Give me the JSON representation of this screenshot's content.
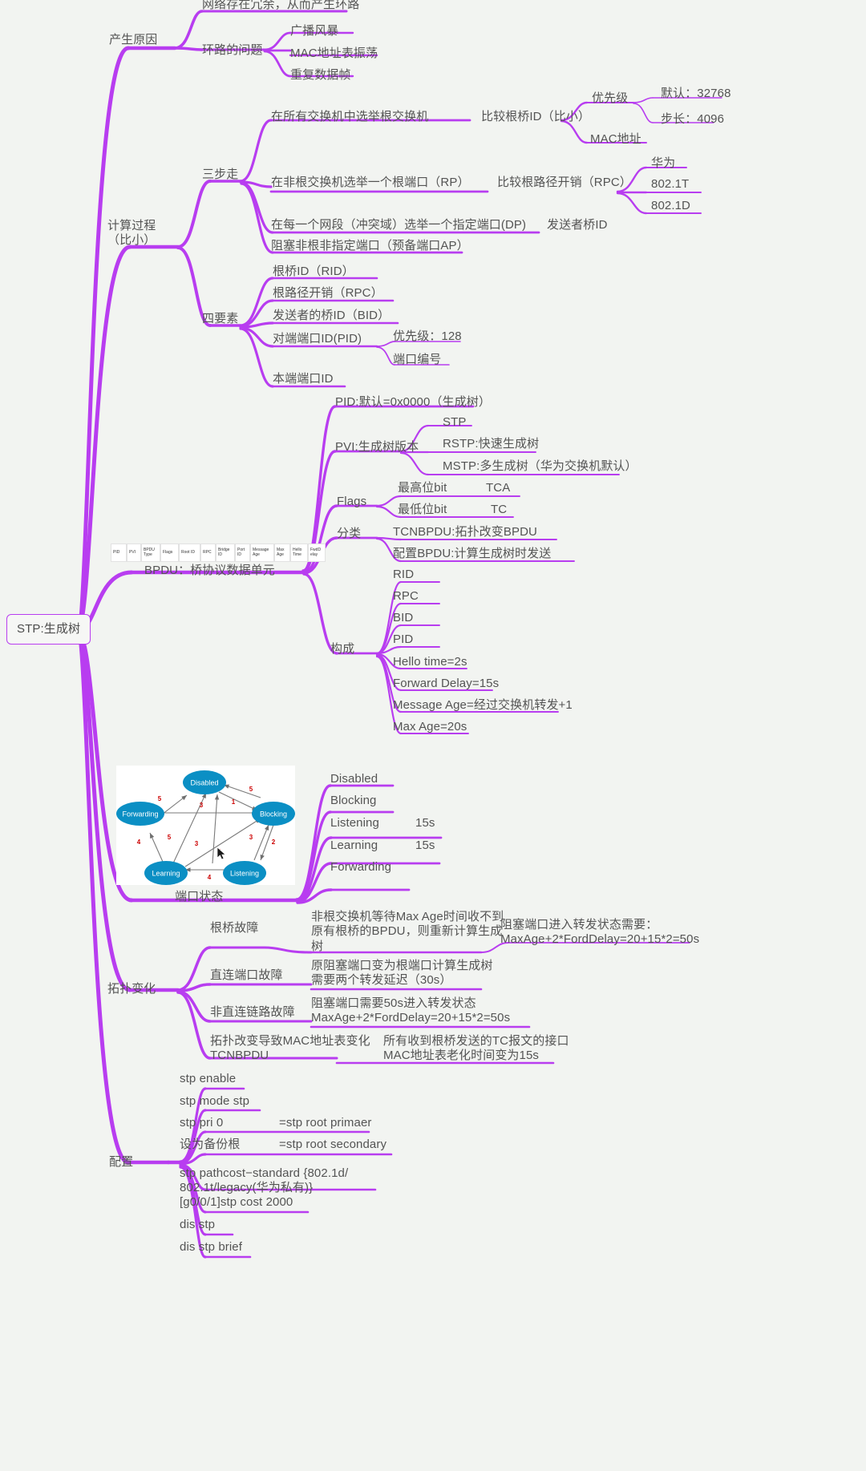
{
  "theme": {
    "background": "#f2f4f1",
    "branch_color": "#b83df0",
    "text_color": "#545454",
    "node_color": "#0b8fc4",
    "number_color": "#cc0000"
  },
  "root": {
    "label": "STP:生成树"
  },
  "branch1": {
    "label": "产生原因",
    "items": [
      {
        "label": "网络存在冗余，从而产生环路"
      },
      {
        "label": "环路的问题",
        "children": [
          {
            "label": "广播风暴"
          },
          {
            "label": "MAC地址表振荡"
          },
          {
            "label": "重复数据帧"
          }
        ]
      }
    ]
  },
  "branch2": {
    "label": "计算过程\n（比小）",
    "groups": [
      {
        "label": "三步走",
        "items": [
          {
            "label": "在所有交换机中选举根交换机",
            "detail": "比较根桥ID（比小）",
            "children": [
              {
                "label": "优先级",
                "children": [
                  {
                    "label": "默认：32768"
                  },
                  {
                    "label": "步长：4096"
                  }
                ]
              },
              {
                "label": "MAC地址"
              }
            ]
          },
          {
            "label": "在非根交换机选举一个根端口（RP）",
            "detail": "比较根路径开销（RPC）",
            "children": [
              {
                "label": "华为"
              },
              {
                "label": "802.1T"
              },
              {
                "label": "802.1D"
              }
            ]
          },
          {
            "label": "在每一个网段（冲突域）选举一个指定端口(DP)",
            "detail": "发送者桥ID"
          },
          {
            "label": "阻塞非根非指定端口（预备端口AP）"
          }
        ]
      },
      {
        "label": "四要素",
        "items": [
          {
            "label": "根桥ID（RID）"
          },
          {
            "label": "根路径开销（RPC）"
          },
          {
            "label": "发送者的桥ID（BID）"
          },
          {
            "label": "对端端口ID(PID)",
            "children": [
              {
                "label": "优先级：128"
              },
              {
                "label": "端口编号"
              }
            ]
          },
          {
            "label": "本端端口ID"
          }
        ]
      }
    ]
  },
  "branch3": {
    "label": "BPDU：桥协议数据单元",
    "frame_fields": [
      "PID",
      "PVI",
      "BPDU\nType",
      "Flags",
      "Root ID",
      "RPC",
      "Bridge\nID",
      "Port\nID",
      "Message\nAge",
      "Max\nAge",
      "Hello\nTime",
      "FwdD\nelay"
    ],
    "items": [
      {
        "label": "PID:默认=0x0000（生成树）"
      },
      {
        "label": "PVI:生成树版本",
        "children": [
          {
            "label": "STP"
          },
          {
            "label": "RSTP:快速生成树"
          },
          {
            "label": "MSTP:多生成树（华为交换机默认）"
          }
        ]
      },
      {
        "label": "Flags",
        "children": [
          {
            "label": "最高位bit",
            "detail": "TCA"
          },
          {
            "label": "最低位bit",
            "detail": "TC"
          }
        ]
      },
      {
        "label": "分类",
        "children": [
          {
            "label": "TCNBPDU:拓扑改变BPDU"
          },
          {
            "label": "配置BPDU:计算生成树时发送"
          }
        ]
      },
      {
        "label": "构成",
        "children": [
          {
            "label": "RID"
          },
          {
            "label": "RPC"
          },
          {
            "label": "BID"
          },
          {
            "label": "PID"
          },
          {
            "label": "Hello time=2s"
          },
          {
            "label": "Forward Delay=15s"
          },
          {
            "label": "Message Age=经过交换机转发+1"
          },
          {
            "label": "Max Age=20s"
          }
        ]
      }
    ]
  },
  "branch4": {
    "label": "端口状态",
    "diagram": {
      "nodes": [
        {
          "id": "Disabled",
          "label": "Disabled"
        },
        {
          "id": "Forwarding",
          "label": "Forwarding"
        },
        {
          "id": "Blocking",
          "label": "Blocking"
        },
        {
          "id": "Learning",
          "label": "Learning"
        },
        {
          "id": "Listening",
          "label": "Listening"
        }
      ],
      "edge_numbers": [
        "5",
        "5",
        "1",
        "3",
        "5",
        "4",
        "3",
        "5",
        "3",
        "2",
        "4"
      ]
    },
    "items": [
      {
        "label": "Disabled",
        "detail": ""
      },
      {
        "label": "Blocking",
        "detail": ""
      },
      {
        "label": "Listening",
        "detail": "15s"
      },
      {
        "label": "Learning",
        "detail": "15s"
      },
      {
        "label": "Forwarding",
        "detail": ""
      }
    ]
  },
  "branch5": {
    "label": "拓扑变化",
    "items": [
      {
        "label": "根桥故障",
        "detail": "非根交换机等待Max Age时间收不到\n原有根桥的BPDU，则重新计算生成\n树",
        "children": [
          {
            "label": "阻塞端口进入转发状态需要：\nMaxAge+2*FordDelay=20+15*2=50s"
          }
        ]
      },
      {
        "label": "直连端口故障",
        "detail": "原阻塞端口变为根端口计算生成树\n需要两个转发延迟（30s）"
      },
      {
        "label": "非直连链路故障",
        "detail": "阻塞端口需要50s进入转发状态\nMaxAge+2*FordDelay=20+15*2=50s"
      },
      {
        "label": "拓扑改变导致MAC地址表变化\nTCNBPDU",
        "detail": "所有收到根桥发送的TC报文的接口\nMAC地址表老化时间变为15s"
      }
    ]
  },
  "branch6": {
    "label": "配置",
    "items": [
      {
        "label": "stp enable",
        "detail": ""
      },
      {
        "label": "stp mode stp",
        "detail": ""
      },
      {
        "label": "stp pri 0",
        "detail": "=stp root primaer"
      },
      {
        "label": "设为备份根",
        "detail": "=stp root secondary"
      },
      {
        "label": "stp pathcost−standard {802.1d/\n802.1t/legacy(华为私有)}",
        "detail": ""
      },
      {
        "label": "[g0/0/1]stp cost 2000",
        "detail": ""
      },
      {
        "label": "dis stp",
        "detail": ""
      },
      {
        "label": "dis stp brief",
        "detail": ""
      }
    ]
  }
}
